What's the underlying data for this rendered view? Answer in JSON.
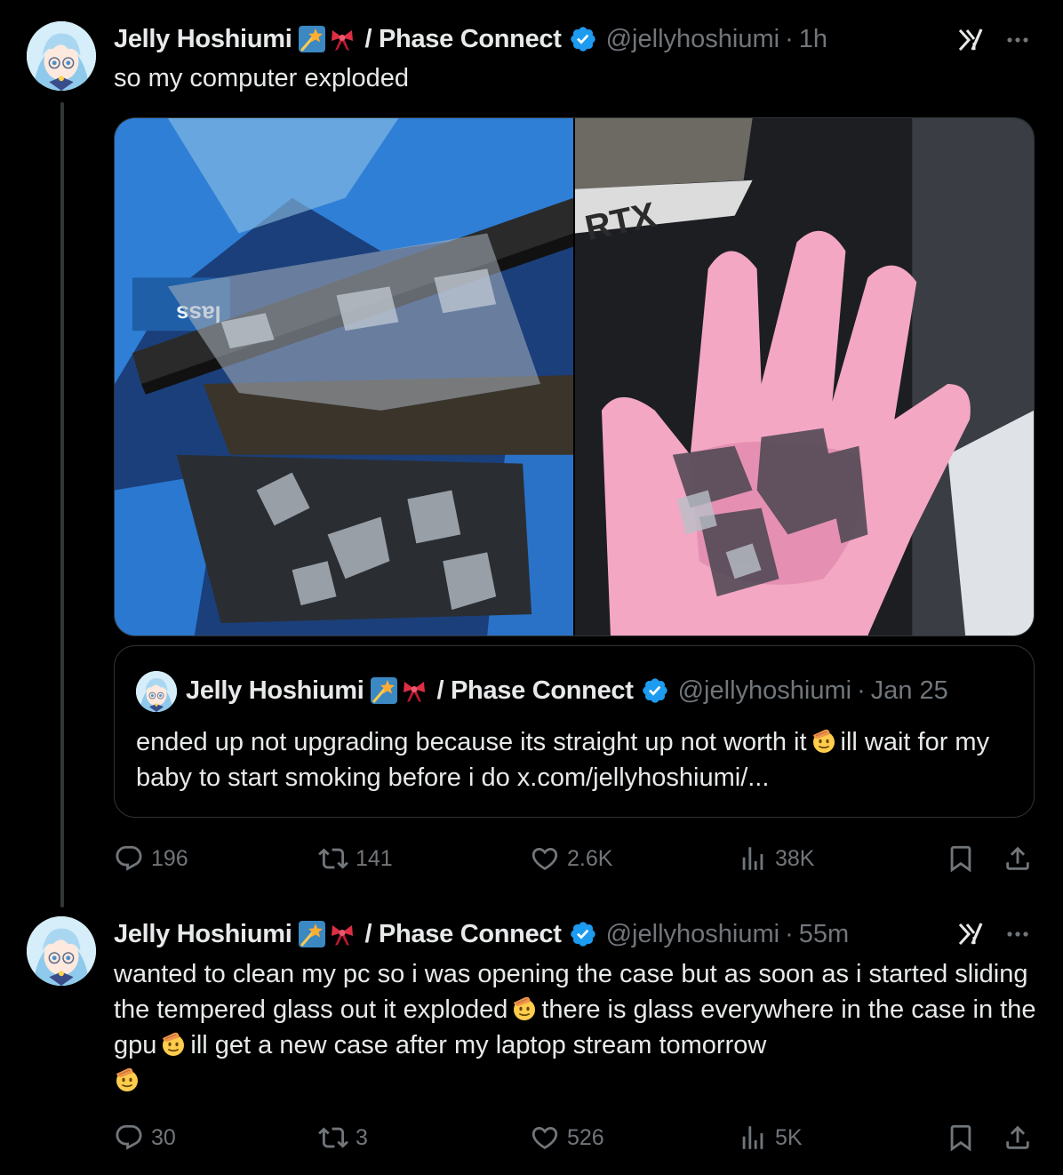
{
  "tweets": [
    {
      "author_name": "Jelly Hoshiumi",
      "affiliation": "/ Phase Connect",
      "handle": "@jellyhoshiumi",
      "separator": "·",
      "time": "1h",
      "text": "so my computer exploded",
      "media": [
        {
          "description": "shattered tempered glass in blue plastic bag",
          "text": "lass"
        },
        {
          "description": "pink gloved hand holding glass shards",
          "text": "RTX"
        }
      ],
      "quote": {
        "author_name": "Jelly Hoshiumi",
        "affiliation": "/ Phase Connect",
        "handle": "@jellyhoshiumi",
        "separator": "·",
        "time": "Jan 25",
        "text_part1": "ended up not upgrading because its straight up not worth it",
        "text_part2": "ill wait for my baby to start smoking before i do x.com/jellyhoshiumi/..."
      },
      "stats": {
        "replies": "196",
        "reposts": "141",
        "likes": "2.6K",
        "views": "38K"
      }
    },
    {
      "author_name": "Jelly Hoshiumi",
      "affiliation": "/ Phase Connect",
      "handle": "@jellyhoshiumi",
      "separator": "·",
      "time": "55m",
      "text_part1": "wanted to clean my pc so i was opening the case but as soon as i started sliding the tempered glass out it exploded",
      "text_part2": "there is glass everywhere in the case in the gpu",
      "text_part3": "ill get a new case after my laptop stream tomorrow",
      "stats": {
        "replies": "30",
        "reposts": "3",
        "likes": "526",
        "views": "5K"
      }
    }
  ],
  "icons": {
    "verified": "verified-badge-icon",
    "shooting_star": "shooting-star-emoji",
    "ribbon": "ribbon-emoji",
    "saluting_face": "saluting-face-emoji",
    "grok": "grok-icon",
    "more": "more-icon",
    "reply": "reply-icon",
    "repost": "repost-icon",
    "like": "like-icon",
    "views": "views-icon",
    "bookmark": "bookmark-icon",
    "share": "share-icon"
  },
  "colors": {
    "background": "#000000",
    "text_primary": "#e7e9ea",
    "text_secondary": "#71767b",
    "border": "#2f3336",
    "verified_blue": "#1d9bf0"
  }
}
